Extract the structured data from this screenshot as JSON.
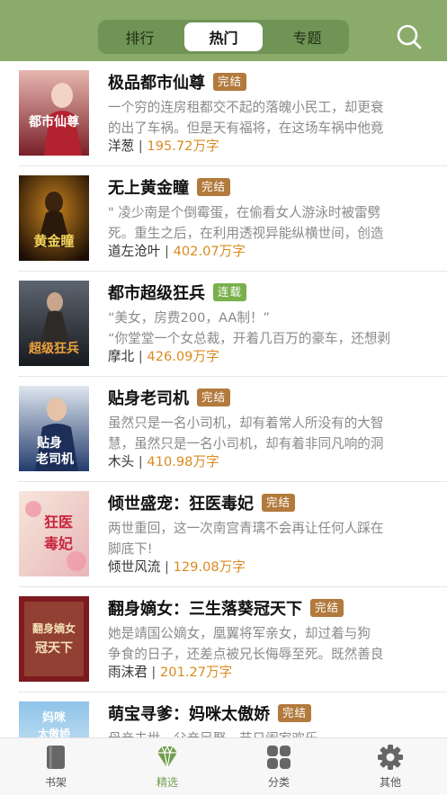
{
  "header": {
    "tabs": [
      {
        "label": "排行"
      },
      {
        "label": "热门"
      },
      {
        "label": "专题"
      }
    ],
    "active_tab": "热门",
    "search_icon": "search-icon"
  },
  "colors": {
    "header_bg": "#8aab6a",
    "accent": "#6f9e4f",
    "badge_complete": "#b37a3d",
    "badge_ongoing": "#7ab04b",
    "count": "#d98b1f"
  },
  "books": [
    {
      "title": "极品都市仙尊",
      "status": "完结",
      "desc": [
        "一个穷的连房租都交不起的落魄小民工，却更衰",
        "的出了车祸。但是天有福将，在这场车祸中他竟"
      ],
      "author": "洋葱",
      "count": "195.72万字"
    },
    {
      "title": "无上黄金瞳",
      "status": "完结",
      "desc": [
        "\" 凌少南是个倒霉蛋，在偷看女人游泳时被雷劈",
        "死。重生之后，在利用透视异能纵横世间，创造"
      ],
      "author": "道左沧叶",
      "count": "402.07万字"
    },
    {
      "title": "都市超级狂兵",
      "status": "连载",
      "desc": [
        "“美女，房费200，AA制！”",
        "“你堂堂一个女总裁，开着几百万的豪车，还想剥"
      ],
      "author": "摩北",
      "count": "426.09万字"
    },
    {
      "title": "贴身老司机",
      "status": "完结",
      "desc": [
        "虽然只是一名小司机，却有着常人所没有的大智",
        "慧，虽然只是一名小司机，却有着非同凡响的洞"
      ],
      "author": "木头",
      "count": "410.98万字"
    },
    {
      "title": "倾世盛宠：狂医毒妃",
      "status": "完结",
      "desc": [
        "两世重回，这一次南宫青璃不会再让任何人踩在",
        "脚底下!"
      ],
      "author": "倾世风流",
      "count": "129.08万字"
    },
    {
      "title": "翻身嫡女：三生落葵冠天下",
      "status": "完结",
      "desc": [
        "    她是靖国公嫡女，凰翼将军亲女，却过着与狗",
        "争食的日子，还差点被兄长侮辱至死。既然善良"
      ],
      "author": "雨沫君",
      "count": "201.27万字"
    },
    {
      "title": "萌宝寻爹：妈咪太傲娇",
      "status": "完结",
      "desc": [
        "母亲去世，父亲另娶，节日阖家欢乐",
        ""
      ],
      "author": "",
      "count": ""
    }
  ],
  "covers": [
    {
      "lines": [
        "都市仙尊"
      ],
      "sub": ""
    },
    {
      "lines": [
        "黄金瞳"
      ],
      "sub": ""
    },
    {
      "lines": [
        "超级狂兵"
      ],
      "sub": ""
    },
    {
      "lines": [
        "贴身",
        "老司机"
      ],
      "sub": ""
    },
    {
      "lines": [
        "狂医",
        "毒妃"
      ],
      "sub": ""
    },
    {
      "lines": [
        "翻身嫡女",
        "冠天下"
      ],
      "sub": ""
    },
    {
      "lines": [
        "妈咪",
        "太傲娇"
      ],
      "sub": ""
    }
  ],
  "tabbar": [
    {
      "label": "书架",
      "icon": "bookshelf-icon"
    },
    {
      "label": "精选",
      "icon": "diamond-icon"
    },
    {
      "label": "分类",
      "icon": "grid-icon"
    },
    {
      "label": "其他",
      "icon": "gear-icon"
    }
  ],
  "active_bottom_tab": "精选"
}
